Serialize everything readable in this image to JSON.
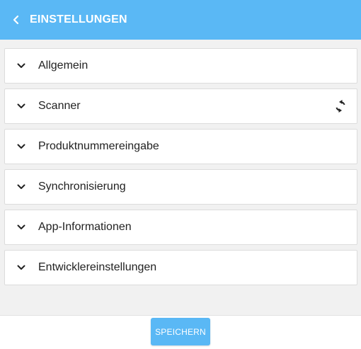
{
  "colors": {
    "primary": "#5ab8f5",
    "background": "#f1f1f1",
    "card": "#ffffff",
    "text": "#222222"
  },
  "header": {
    "title": "EINSTELLUNGEN",
    "back_icon": "chevron-left-icon"
  },
  "sections": [
    {
      "label": "Allgemein",
      "icon": "chevron-down-icon"
    },
    {
      "label": "Scanner",
      "icon": "chevron-down-icon",
      "action_icon": "sync-icon"
    },
    {
      "label": "Produktnummereingabe",
      "icon": "chevron-down-icon"
    },
    {
      "label": "Synchronisierung",
      "icon": "chevron-down-icon"
    },
    {
      "label": "App-Informationen",
      "icon": "chevron-down-icon"
    },
    {
      "label": "Entwicklereinstellungen",
      "icon": "chevron-down-icon"
    }
  ],
  "footer": {
    "save_label": "SPEICHERN"
  }
}
